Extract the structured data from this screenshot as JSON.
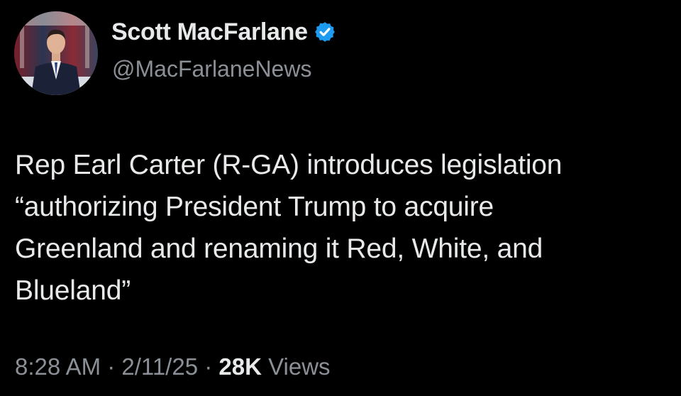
{
  "author": {
    "display_name": "Scott MacFarlane",
    "handle": "@MacFarlaneNews",
    "verified": true,
    "avatar_icon": "avatar-news-anchor"
  },
  "tweet": {
    "text": "Rep Earl Carter (R-GA) introduces legislation\n“authorizing President Trump to acquire\nGreenland and renaming it Red, White, and\nBlueland”"
  },
  "meta": {
    "time": "8:28 AM",
    "separator": " · ",
    "date": "2/11/25",
    "views_count": "28K",
    "views_label": " Views"
  },
  "colors": {
    "background": "#000000",
    "primary_text": "#e7e9ea",
    "secondary_text": "#8b9097",
    "verified_badge": "#1d9bf0"
  }
}
